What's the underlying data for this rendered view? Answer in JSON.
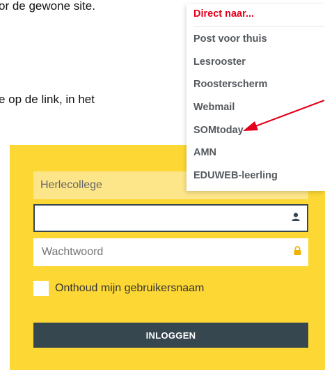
{
  "document": {
    "line1": "or de gewone site.",
    "line2": "e op de link, in het"
  },
  "menu": {
    "header": "Direct naar...",
    "items": [
      {
        "label": "Post voor thuis"
      },
      {
        "label": "Lesrooster"
      },
      {
        "label": "Roosterscherm"
      },
      {
        "label": "Webmail"
      },
      {
        "label": "SOMtoday"
      },
      {
        "label": "AMN"
      },
      {
        "label": "EDUWEB-leerling"
      }
    ]
  },
  "login": {
    "school_select": "Herlecollege",
    "username_value": "",
    "password_placeholder": "Wachtwoord",
    "remember_label": "Onthoud mijn gebruikersnaam",
    "submit_label": "INLOGGEN"
  },
  "icons": {
    "user": "user-icon",
    "lock": "lock-icon",
    "dropdown": "chevron-down-icon",
    "arrow": "red-arrow-annotation"
  },
  "colors": {
    "panel": "#fdd835",
    "select_bg": "#fde58a",
    "button": "#37474f",
    "menu_header": "#e3001b",
    "menu_item": "#555a5f",
    "arrow": "#e3001b",
    "lock": "#f0b400"
  }
}
